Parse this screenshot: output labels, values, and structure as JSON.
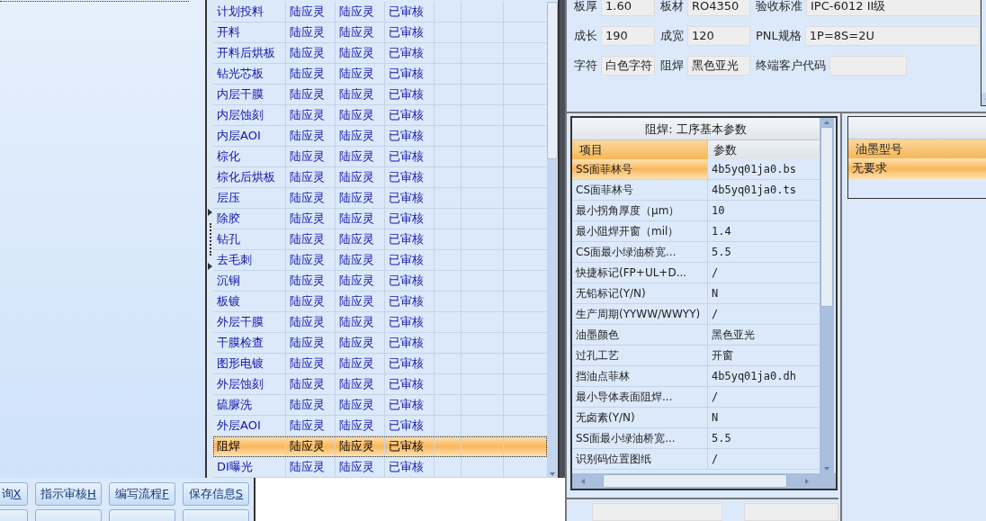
{
  "buttons": [
    {
      "label": "询",
      "hotkey": "X"
    },
    {
      "label": "指示审核",
      "hotkey": "H"
    },
    {
      "label": "编写流程",
      "hotkey": "F"
    },
    {
      "label": "保存信息",
      "hotkey": "S"
    }
  ],
  "process_table": {
    "rows": [
      {
        "cells": [
          "计划投料",
          "陆应灵",
          "陆应灵",
          "已审核"
        ],
        "selected": false
      },
      {
        "cells": [
          "开料",
          "陆应灵",
          "陆应灵",
          "已审核"
        ],
        "selected": false
      },
      {
        "cells": [
          "开料后烘板",
          "陆应灵",
          "陆应灵",
          "已审核"
        ],
        "selected": false
      },
      {
        "cells": [
          "钻光芯板",
          "陆应灵",
          "陆应灵",
          "已审核"
        ],
        "selected": false
      },
      {
        "cells": [
          "内层干膜",
          "陆应灵",
          "陆应灵",
          "已审核"
        ],
        "selected": false
      },
      {
        "cells": [
          "内层蚀刻",
          "陆应灵",
          "陆应灵",
          "已审核"
        ],
        "selected": false
      },
      {
        "cells": [
          "内层AOI",
          "陆应灵",
          "陆应灵",
          "已审核"
        ],
        "selected": false
      },
      {
        "cells": [
          "棕化",
          "陆应灵",
          "陆应灵",
          "已审核"
        ],
        "selected": false
      },
      {
        "cells": [
          "棕化后烘板",
          "陆应灵",
          "陆应灵",
          "已审核"
        ],
        "selected": false
      },
      {
        "cells": [
          "层压",
          "陆应灵",
          "陆应灵",
          "已审核"
        ],
        "selected": false
      },
      {
        "cells": [
          "除胶",
          "陆应灵",
          "陆应灵",
          "已审核"
        ],
        "selected": false
      },
      {
        "cells": [
          "钻孔",
          "陆应灵",
          "陆应灵",
          "已审核"
        ],
        "selected": false
      },
      {
        "cells": [
          "去毛刺",
          "陆应灵",
          "陆应灵",
          "已审核"
        ],
        "selected": false
      },
      {
        "cells": [
          "沉铜",
          "陆应灵",
          "陆应灵",
          "已审核"
        ],
        "selected": false
      },
      {
        "cells": [
          "板镀",
          "陆应灵",
          "陆应灵",
          "已审核"
        ],
        "selected": false
      },
      {
        "cells": [
          "外层干膜",
          "陆应灵",
          "陆应灵",
          "已审核"
        ],
        "selected": false
      },
      {
        "cells": [
          "干膜检查",
          "陆应灵",
          "陆应灵",
          "已审核"
        ],
        "selected": false
      },
      {
        "cells": [
          "图形电镀",
          "陆应灵",
          "陆应灵",
          "已审核"
        ],
        "selected": false
      },
      {
        "cells": [
          "外层蚀刻",
          "陆应灵",
          "陆应灵",
          "已审核"
        ],
        "selected": false
      },
      {
        "cells": [
          "硫脲洗",
          "陆应灵",
          "陆应灵",
          "已审核"
        ],
        "selected": false
      },
      {
        "cells": [
          "外层AOI",
          "陆应灵",
          "陆应灵",
          "已审核"
        ],
        "selected": false
      },
      {
        "cells": [
          "阻焊",
          "陆应灵",
          "陆应灵",
          "已审核"
        ],
        "selected": true
      },
      {
        "cells": [
          "DI曝光",
          "陆应灵",
          "陆应灵",
          "已审核"
        ],
        "selected": false
      }
    ]
  },
  "board_form": {
    "rows": [
      [
        {
          "label": "板厚",
          "value": "1.60"
        },
        {
          "label": "板材",
          "value": "RO4350"
        },
        {
          "label": "验收标准",
          "value": "IPC-6012 II级"
        }
      ],
      [
        {
          "label": "成长",
          "value": "190"
        },
        {
          "label": "成宽",
          "value": "120"
        },
        {
          "label": "PNL规格",
          "value": "1P=8S=2U"
        }
      ],
      [
        {
          "label": "字符",
          "value": "白色字符"
        },
        {
          "label": "阻焊",
          "value": "黑色亚光"
        },
        {
          "label": "终端客户代码"
        }
      ]
    ]
  },
  "params": {
    "title": "阻焊: 工序基本参数",
    "columns": [
      "项目",
      "参数"
    ],
    "rows": [
      {
        "item": "SS面菲林号",
        "value": "4b5yq01ja0.bs",
        "selected": true
      },
      {
        "item": "CS面菲林号",
        "value": "4b5yq01ja0.ts",
        "selected": false
      },
      {
        "item": "最小拐角厚度（μm）",
        "value": "10",
        "selected": false
      },
      {
        "item": "最小阻焊开窗（mil）",
        "value": "1.4",
        "selected": false
      },
      {
        "item": "CS面最小绿油桥宽...",
        "value": "5.5",
        "selected": false
      },
      {
        "item": "快捷标记(FP+UL+D...",
        "value": "/",
        "selected": false
      },
      {
        "item": "无铅标记(Y/N)",
        "value": "N",
        "selected": false
      },
      {
        "item": "生产周期(YYWW/WWYY)",
        "value": "/",
        "selected": false
      },
      {
        "item": "油墨颜色",
        "value": "黑色亚光",
        "selected": false
      },
      {
        "item": "过孔工艺",
        "value": "开窗",
        "selected": false
      },
      {
        "item": "挡油点菲林",
        "value": "4b5yq01ja0.dh",
        "selected": false
      },
      {
        "item": "最小导体表面阻焊...",
        "value": "/",
        "selected": false
      },
      {
        "item": "无卤素(Y/N)",
        "value": "N",
        "selected": false
      },
      {
        "item": "SS面最小绿油桥宽...",
        "value": "5.5",
        "selected": false
      },
      {
        "item": "识别码位置图纸",
        "value": "/",
        "selected": false
      }
    ]
  },
  "ink": {
    "column": "油墨型号",
    "rows": [
      {
        "text": "无要求",
        "selected": true
      }
    ]
  }
}
